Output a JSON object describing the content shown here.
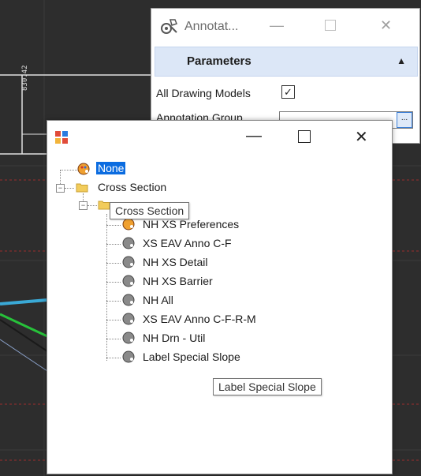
{
  "annotation_panel": {
    "title": "Annotat...",
    "section_header": "Parameters",
    "all_drawing_models_label": "All Drawing Models",
    "all_drawing_models_checked": true,
    "annotation_group_label": "Annotation Group",
    "browse_button_label": "..."
  },
  "cad": {
    "vertical_label": "830.42"
  },
  "tree_dialog": {
    "nodes": {
      "none": "None",
      "cross_section": "Cross Section",
      "cross_section_child": "Cross Section"
    },
    "items": [
      "NH XS Preferences",
      "XS EAV Anno C-F",
      "NH XS Detail",
      "NH XS Barrier",
      "NH All",
      "XS EAV Anno C-F-R-M",
      "NH Drn - Util",
      "Label Special Slope"
    ],
    "hover_tooltip": "Label Special Slope",
    "cross_section_tooltip": "Cross Section"
  },
  "colors": {
    "selection": "#0b6ce0",
    "folder": "#f2cc5b",
    "param_bar": "#dce7f7"
  },
  "icons": {
    "annotation_app": "annotation-settings-icon",
    "tree_window": "tree-window-icon",
    "node": "palette-icon",
    "folder": "folder-icon"
  }
}
